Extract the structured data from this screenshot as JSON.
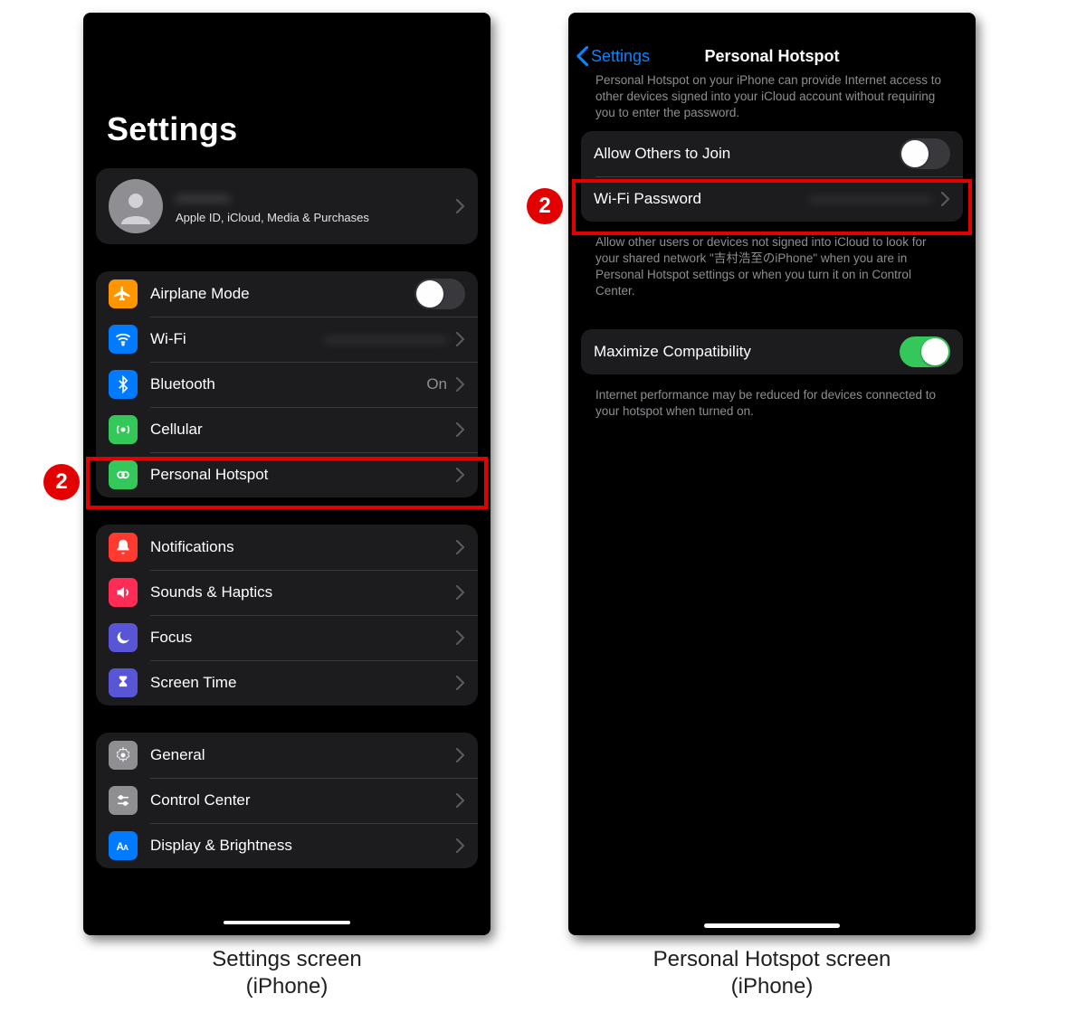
{
  "callout_number": "2",
  "captions": {
    "left_line1": "Settings screen",
    "left_line2": "(iPhone)",
    "right_line1": "Personal Hotspot screen",
    "right_line2": "(iPhone)"
  },
  "left": {
    "title": "Settings",
    "profile": {
      "name_placeholder": "———",
      "subtitle": "Apple ID, iCloud, Media & Purchases"
    },
    "group1": {
      "airplane": "Airplane Mode",
      "wifi": "Wi-Fi",
      "wifi_value_placeholder": "————————",
      "bluetooth": "Bluetooth",
      "bluetooth_value": "On",
      "cellular": "Cellular",
      "hotspot": "Personal Hotspot"
    },
    "group2": {
      "notifications": "Notifications",
      "sounds": "Sounds & Haptics",
      "focus": "Focus",
      "screentime": "Screen Time"
    },
    "group3": {
      "general": "General",
      "control_center": "Control Center",
      "display": "Display & Brightness"
    }
  },
  "right": {
    "back_label": "Settings",
    "title": "Personal Hotspot",
    "intro_note": "Personal Hotspot on your iPhone can provide Internet access to other devices signed into your iCloud account without requiring you to enter the password.",
    "allow_label": "Allow Others to Join",
    "wifi_pw_label": "Wi-Fi Password",
    "wifi_pw_value_placeholder": "————————",
    "allow_note": "Allow other users or devices not signed into iCloud to look for your shared network \"吉村浩至のiPhone\" when you are in Personal Hotspot settings or when you turn it on in Control Center.",
    "maxcompat_label": "Maximize Compatibility",
    "maxcompat_note": "Internet performance may be reduced for devices connected to your hotspot when turned on."
  },
  "colors": {
    "airplane": "#ff9500",
    "wifi": "#007aff",
    "bluetooth": "#007aff",
    "cellular": "#34c759",
    "hotspot": "#34c759",
    "notifications": "#ff3b30",
    "sounds": "#ff2d55",
    "focus": "#5856d6",
    "screentime": "#5856d6",
    "general": "#8e8e93",
    "control_center": "#8e8e93",
    "display": "#007aff"
  }
}
